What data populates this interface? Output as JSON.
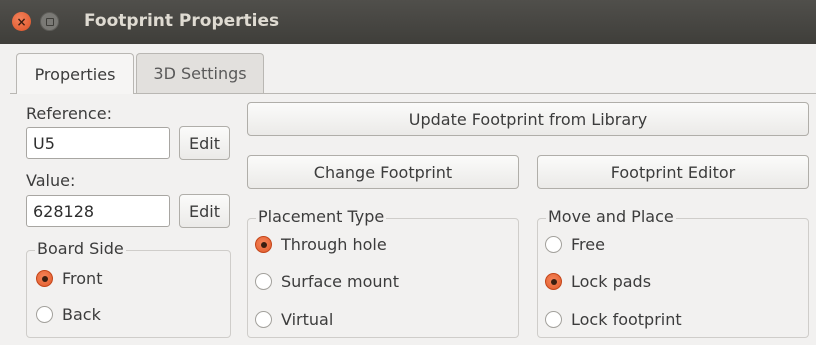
{
  "window": {
    "title": "Footprint Properties"
  },
  "tabs": [
    {
      "label": "Properties",
      "active": true
    },
    {
      "label": "3D Settings",
      "active": false
    }
  ],
  "reference": {
    "label": "Reference:",
    "value": "U5",
    "edit_label": "Edit"
  },
  "value": {
    "label": "Value:",
    "value": "628128",
    "edit_label": "Edit"
  },
  "board_side": {
    "title": "Board Side",
    "options": [
      {
        "label": "Front",
        "selected": true
      },
      {
        "label": "Back",
        "selected": false
      }
    ]
  },
  "buttons": {
    "update_footprint": "Update Footprint from Library",
    "change_footprint": "Change Footprint",
    "footprint_editor": "Footprint Editor"
  },
  "placement_type": {
    "title": "Placement Type",
    "options": [
      {
        "label": "Through hole",
        "selected": true
      },
      {
        "label": "Surface mount",
        "selected": false
      },
      {
        "label": "Virtual",
        "selected": false
      }
    ]
  },
  "move_and_place": {
    "title": "Move and Place",
    "options": [
      {
        "label": "Free",
        "selected": false
      },
      {
        "label": "Lock pads",
        "selected": true
      },
      {
        "label": "Lock footprint",
        "selected": false
      }
    ]
  },
  "colors": {
    "titlebar": "#46453f",
    "accent_radio": "#e05a2a",
    "window_bg": "#f2f1f0"
  }
}
